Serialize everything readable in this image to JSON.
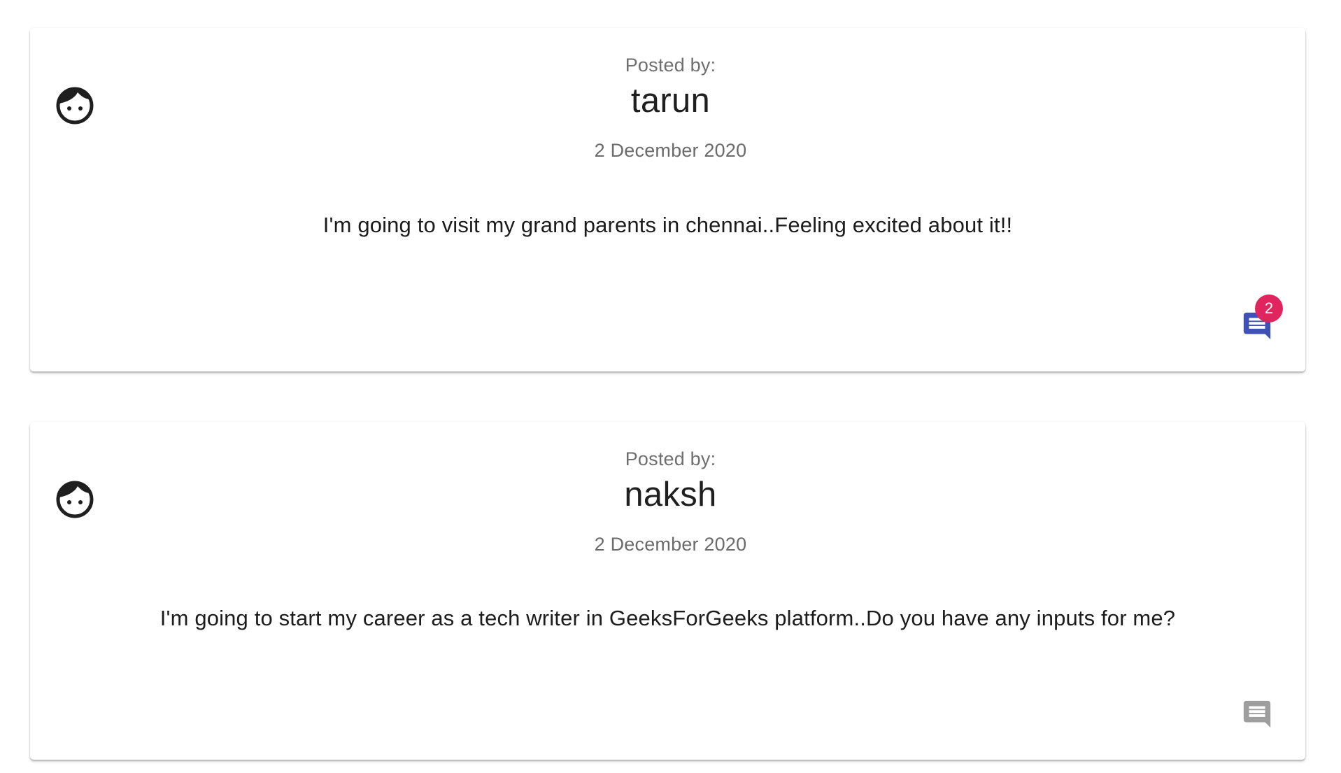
{
  "posts": [
    {
      "posted_by_label": "Posted by:",
      "username": "tarun",
      "date": "2 December 2020",
      "body": "I'm going to visit my grand parents in chennai..Feeling excited about it!!",
      "comment_count": "2",
      "comment_icon_color": "#3f51b5",
      "avatar_icon": "face-icon"
    },
    {
      "posted_by_label": "Posted by:",
      "username": "naksh",
      "date": "2 December 2020",
      "body": "I'm going to start my career as a tech writer in GeeksForGeeks platform..Do you have any inputs for me?",
      "comment_icon_color": "#9e9e9e",
      "avatar_icon": "face-icon"
    }
  ],
  "colors": {
    "badge": "#e0245e",
    "active_comment_icon": "#3f51b5",
    "inactive_comment_icon": "#9e9e9e"
  }
}
